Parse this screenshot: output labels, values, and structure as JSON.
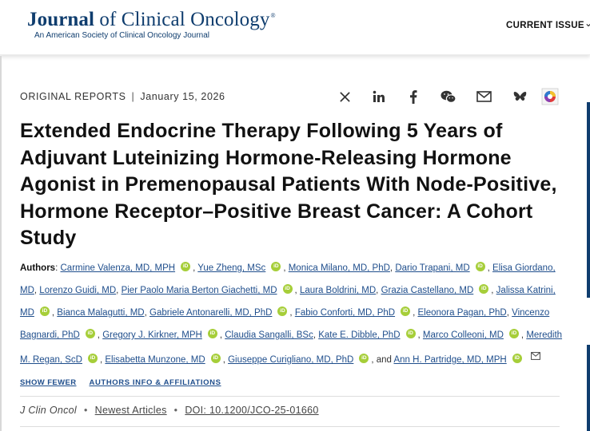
{
  "header": {
    "journal_name_prefix": "Journal",
    "journal_name_rest": " of Clinical Oncology",
    "registered_mark": "®",
    "journal_subtitle": "An American Society of Clinical Oncology Journal",
    "current_issue_label": "CURRENT ISSUE",
    "chevron": "⌄"
  },
  "article": {
    "type": "ORIGINAL REPORTS",
    "separator": "|",
    "date": "January 15, 2026",
    "title": "Extended Endocrine Therapy Following 5 Years of Adjuvant Luteinizing Hormone-Releasing Hormone Agonist in Premenopausal Patients With Node-Positive, Hormone Receptor–Positive Breast Cancer: A Cohort Study"
  },
  "share": {
    "icons": [
      "x-icon",
      "linkedin-icon",
      "facebook-icon",
      "wechat-icon",
      "email-icon",
      "bluesky-icon",
      "altmetric-badge"
    ]
  },
  "authors": {
    "label": "Authors",
    "colon": ":",
    "list": [
      "Carmine Valenza, MD, MPH",
      "Yue Zheng, MSc",
      "Monica Milano, MD, PhD",
      "Dario Trapani, MD",
      "Elisa Giordano, MD",
      "Lorenzo Guidi, MD",
      "Pier Paolo Maria Berton Giachetti, MD",
      "Laura Boldrini, MD",
      "Grazia Castellano, MD",
      "Jalissa Katrini, MD",
      "Bianca Malagutti, MD",
      "Gabriele Antonarelli, MD, PhD",
      "Fabio Conforti, MD, PhD",
      "Eleonora Pagan, PhD",
      "Vincenzo Bagnardi, PhD",
      "Gregory J. Kirkner, MPH",
      "Claudia Sangalli, BSc",
      "Kate E. Dibble, PhD",
      "Marco Colleoni, MD",
      "Meredith M. Regan, ScD",
      "Elisabetta Munzone, MD",
      "Giuseppe Curigliano, MD, PhD",
      "Ann H. Partridge, MD, MPH"
    ],
    "orcid_text": "iD",
    "and_text": ", and",
    "comma": ",",
    "show_fewer": "SHOW FEWER",
    "authors_info": "AUTHORS INFO & AFFILIATIONS"
  },
  "citation": {
    "journal_abbrev": "J Clin Oncol",
    "dot": "•",
    "newest_articles": "Newest Articles",
    "doi": "DOI: 10.1200/JCO-25-01660"
  },
  "colors": {
    "brand_navy": "#0f3d6e",
    "link_blue": "#1f4e8c",
    "orcid_green": "#a6ce39"
  }
}
